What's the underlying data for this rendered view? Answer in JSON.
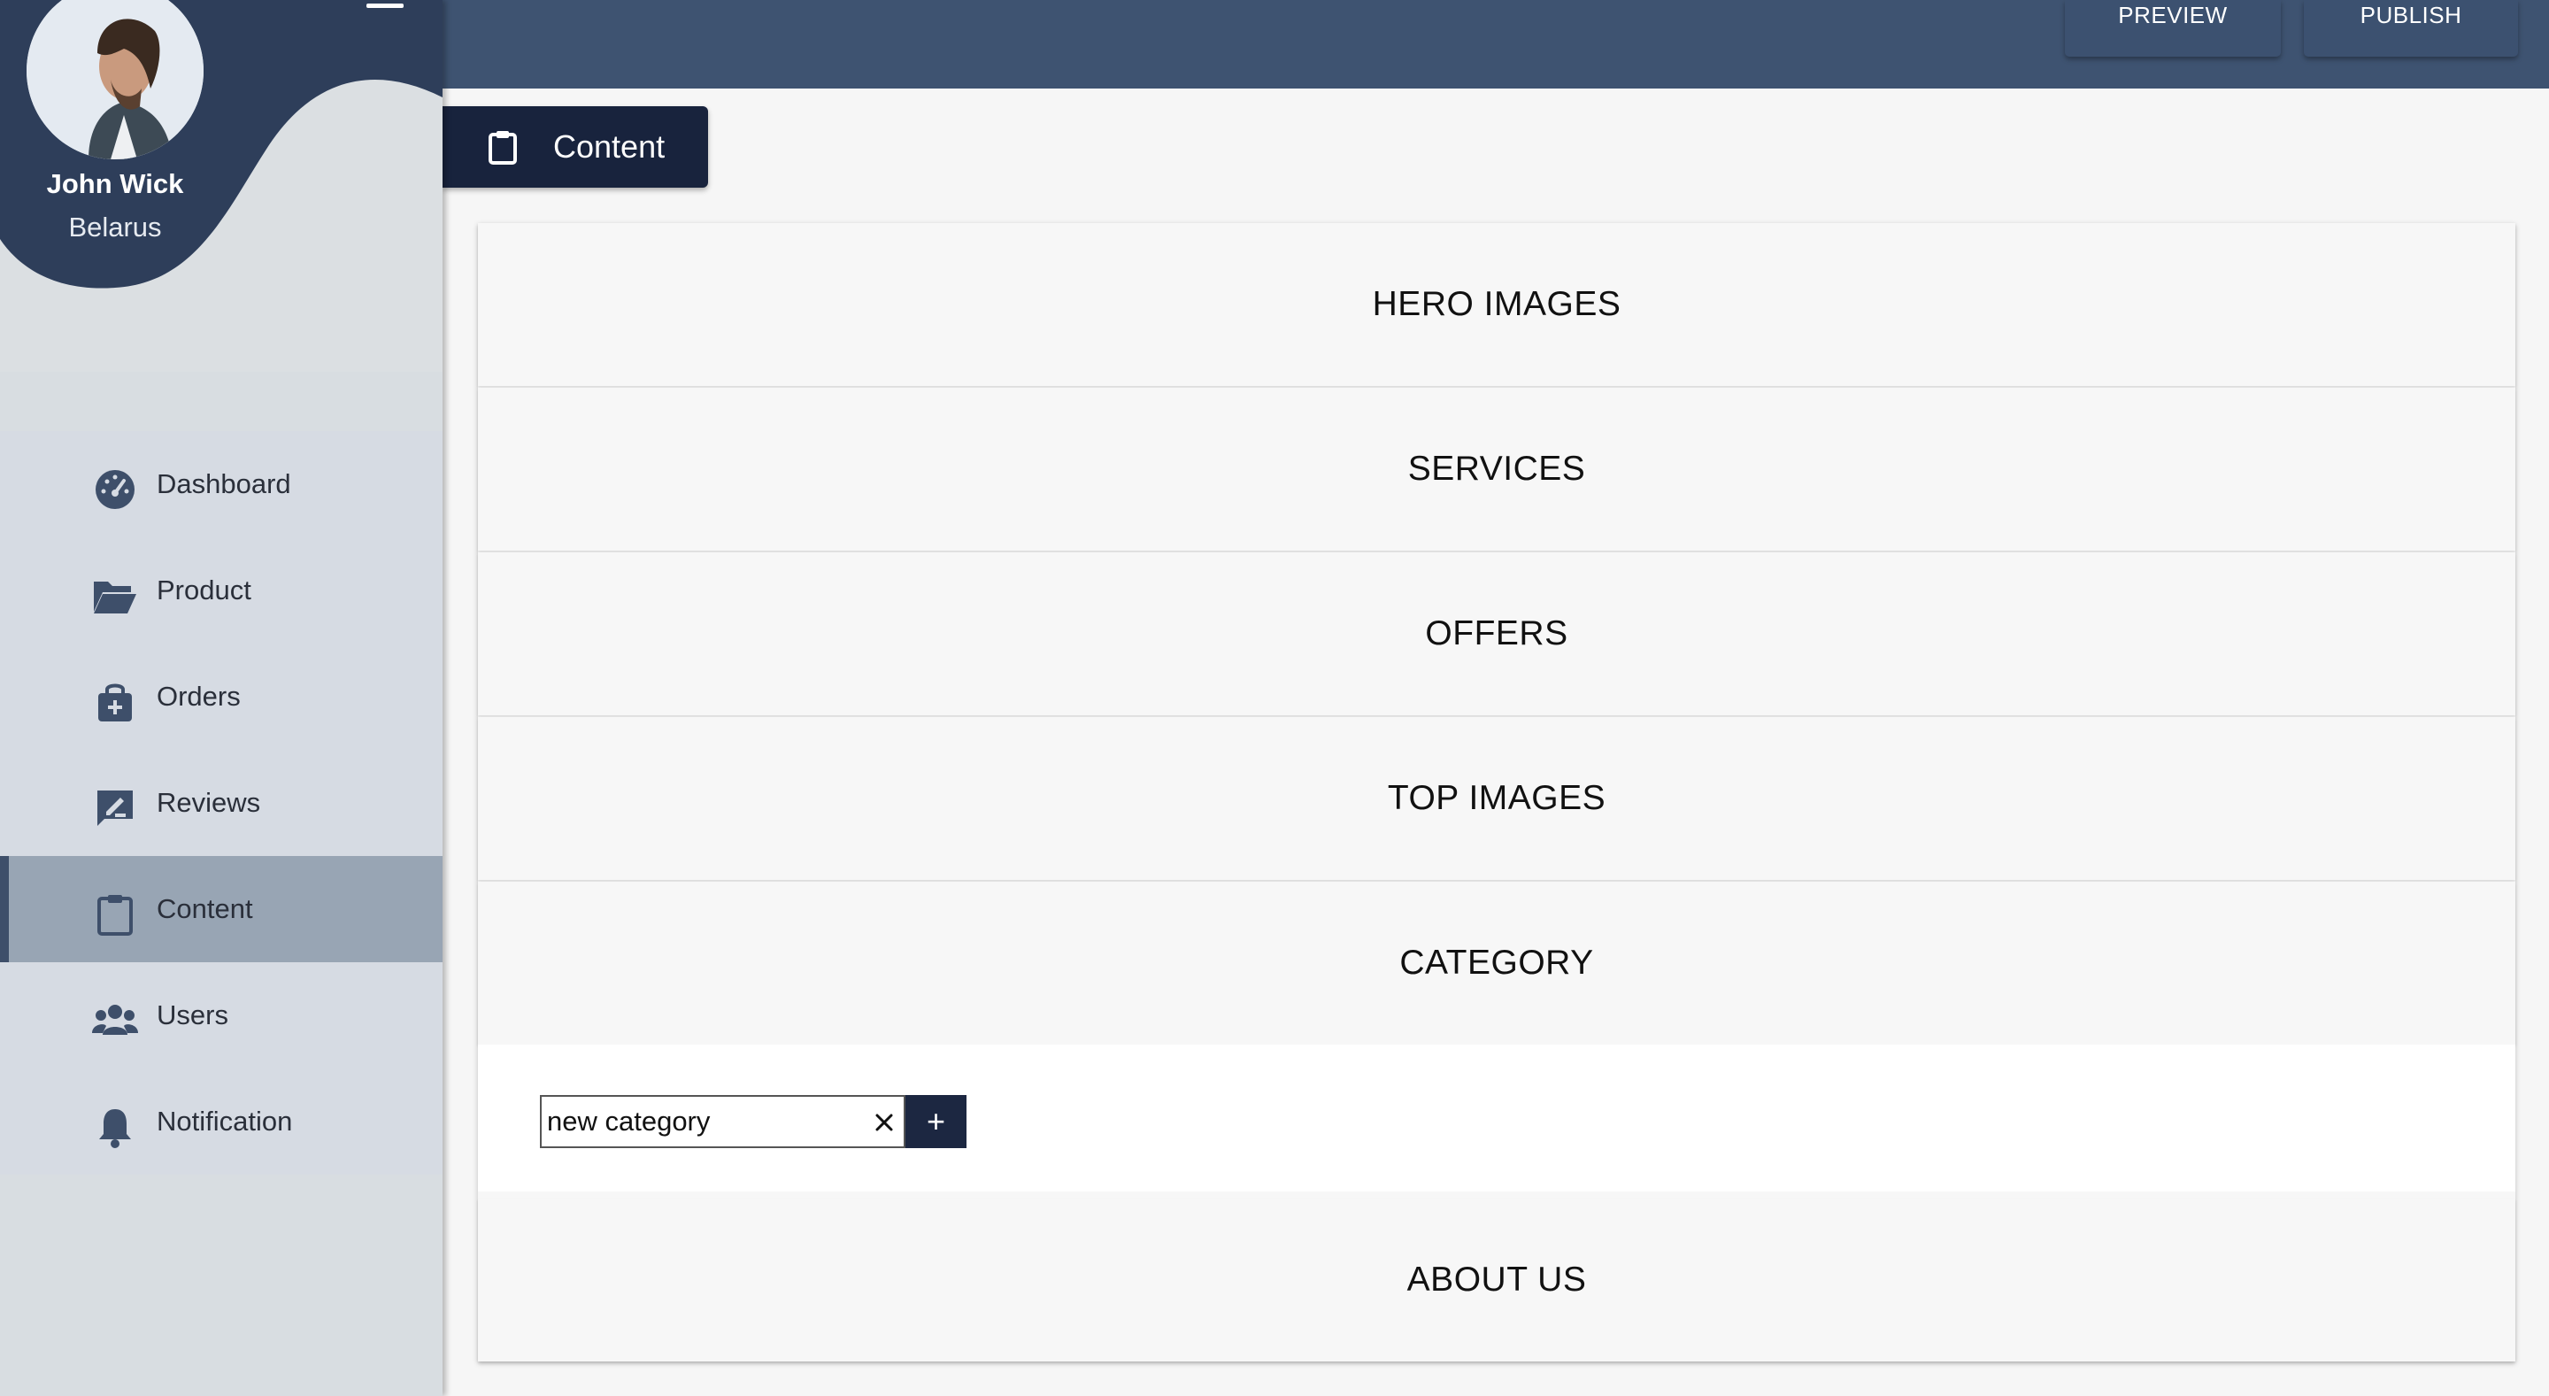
{
  "user": {
    "name": "John Wick",
    "country": "Belarus"
  },
  "nav": [
    {
      "label": "Dashboard",
      "icon": "speedometer-icon"
    },
    {
      "label": "Product",
      "icon": "folder-open-icon"
    },
    {
      "label": "Orders",
      "icon": "shopping-bag-plus-icon"
    },
    {
      "label": "Reviews",
      "icon": "rate-review-icon"
    },
    {
      "label": "Content",
      "icon": "clipboard-icon",
      "active": true
    },
    {
      "label": "Users",
      "icon": "people-icon"
    },
    {
      "label": "Notification",
      "icon": "bell-icon"
    }
  ],
  "topbar": {
    "preview_label": "PREVIEW",
    "publish_label": "PUBLISH"
  },
  "page_tab": {
    "label": "Content",
    "icon": "clipboard-icon"
  },
  "sections": [
    {
      "title": "HERO IMAGES"
    },
    {
      "title": "SERVICES"
    },
    {
      "title": "OFFERS"
    },
    {
      "title": "TOP IMAGES"
    },
    {
      "title": "CATEGORY",
      "expanded": true
    },
    {
      "title": "ABOUT US"
    }
  ],
  "category_form": {
    "input_value": "new category",
    "add_label": "+"
  },
  "colors": {
    "topbar": "#3e5371",
    "sidebar": "#d8dde1",
    "nav_active": "#98a5b4",
    "accent_dark": "#18233d",
    "notification_dot": "#e01515"
  }
}
